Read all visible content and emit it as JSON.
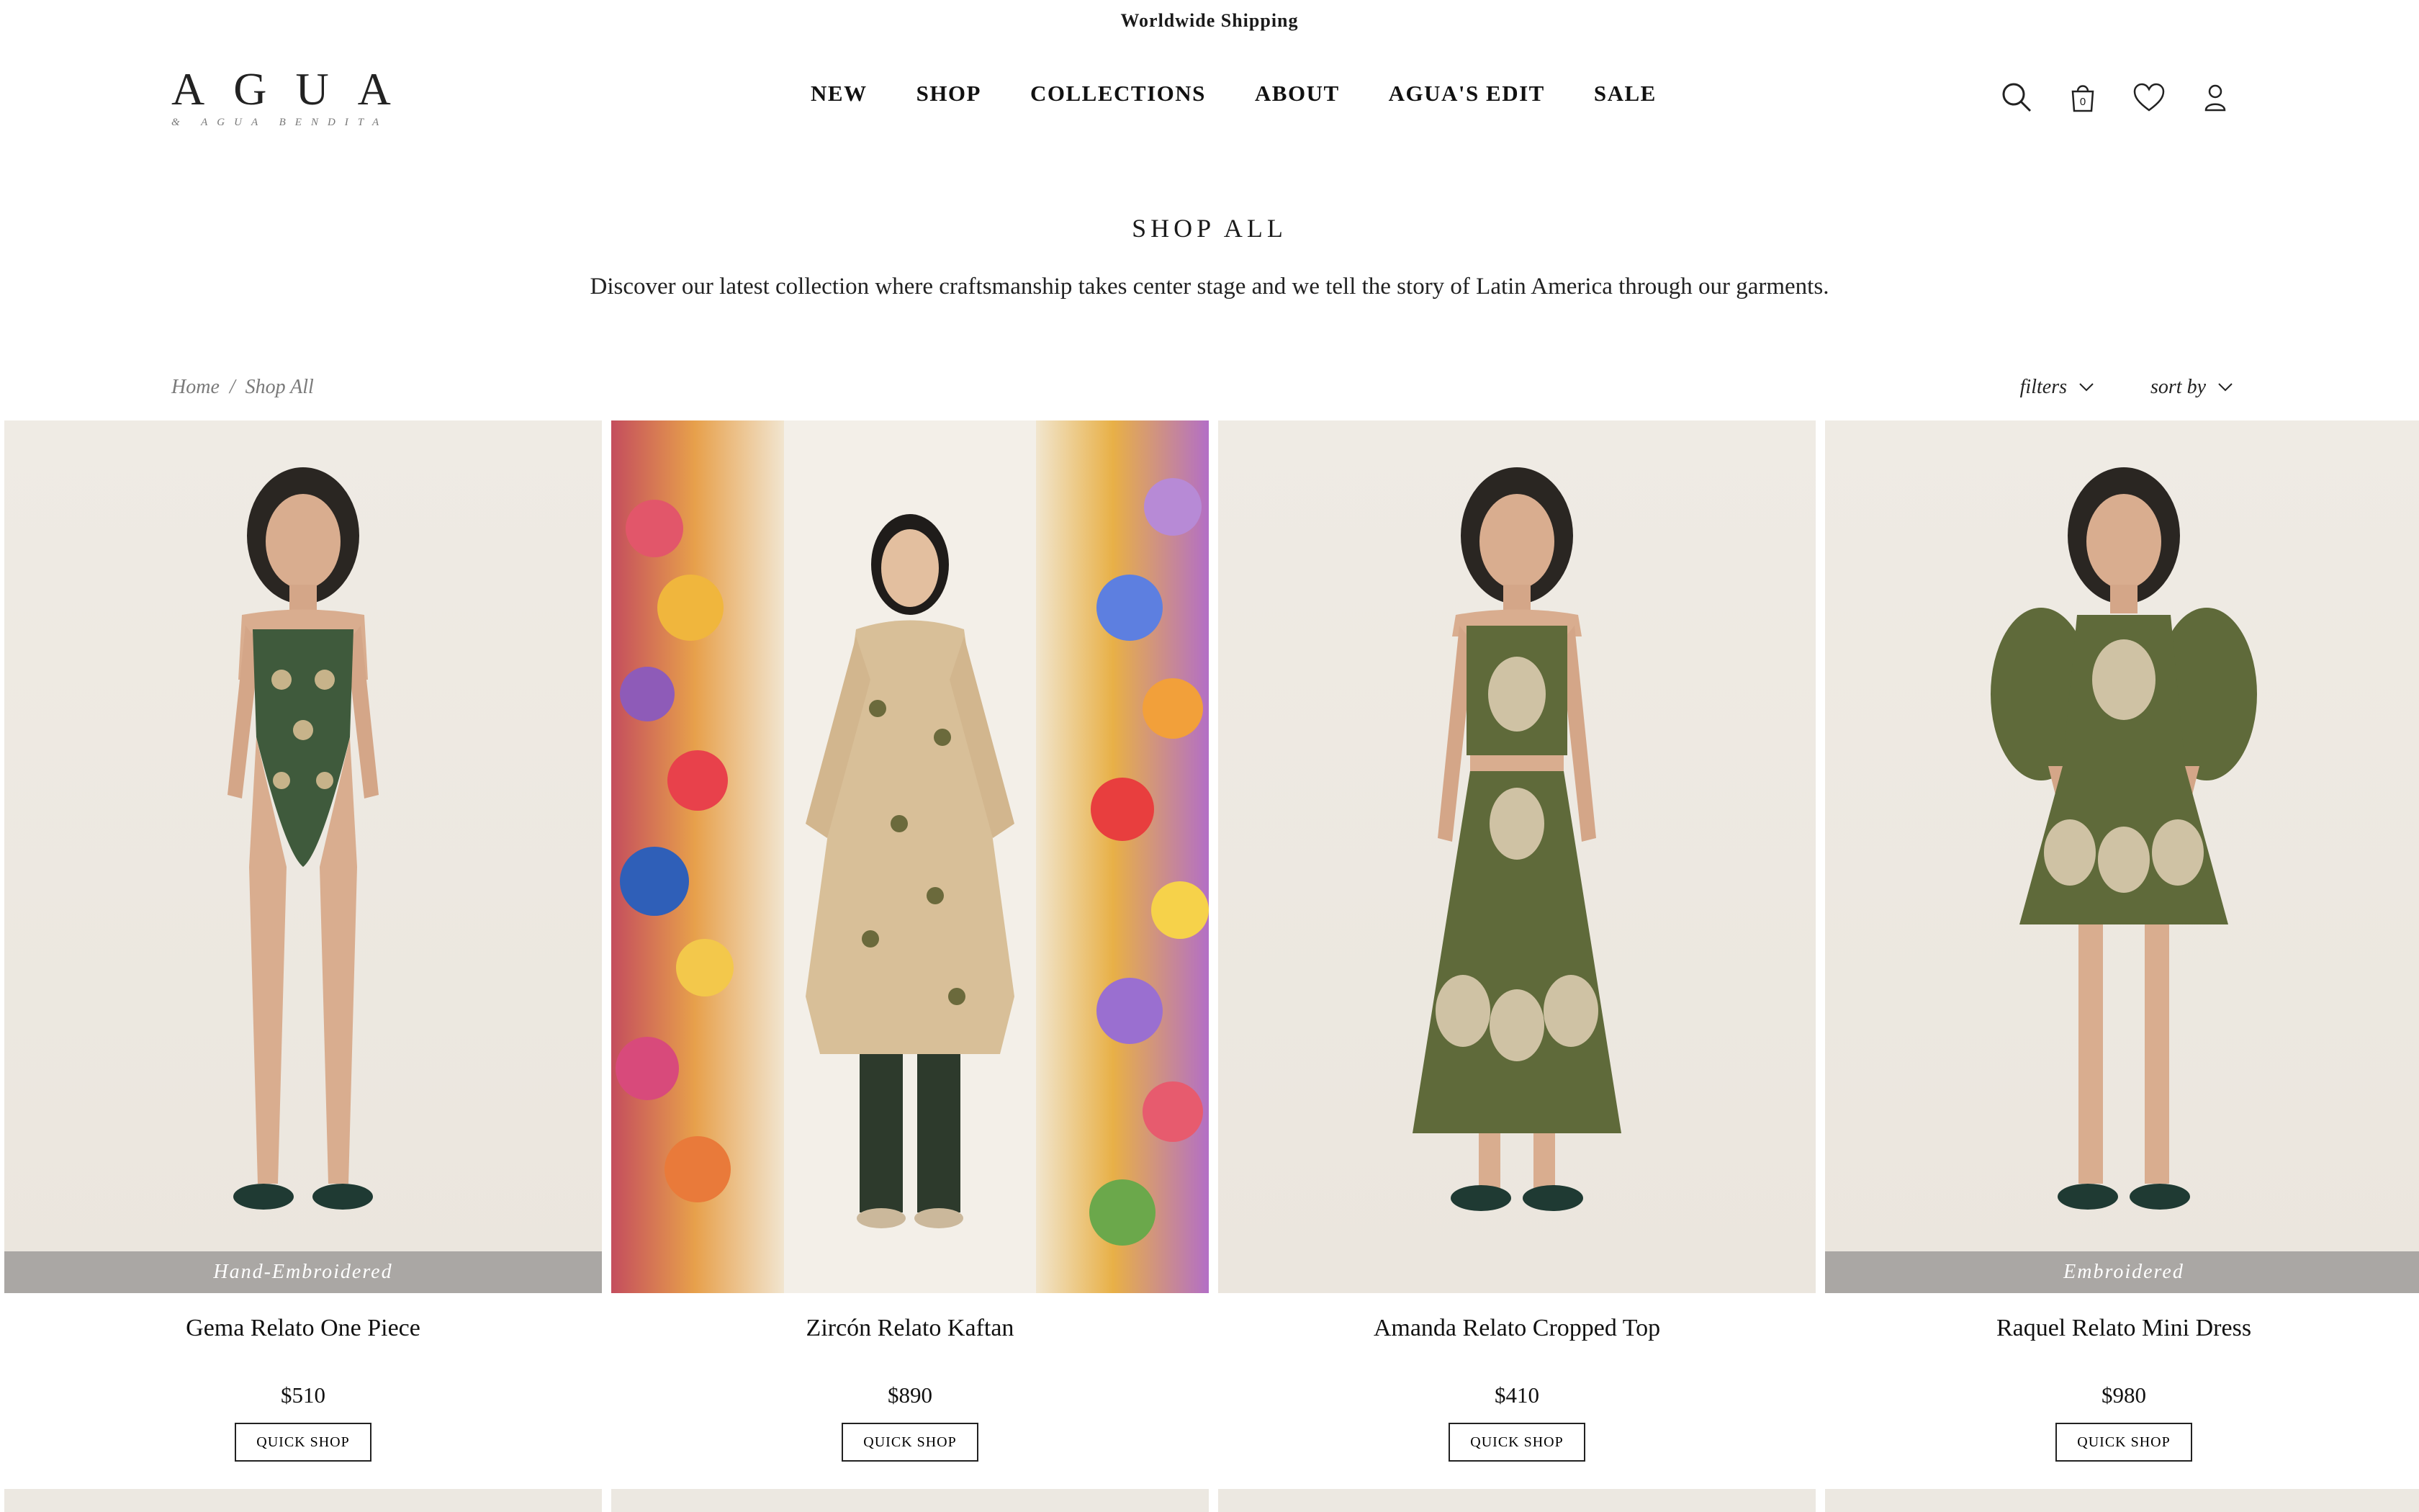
{
  "announcement": "Worldwide Shipping",
  "logo": {
    "main": "AGUA",
    "sub": "& AGUA BENDITA"
  },
  "nav": [
    "NEW",
    "SHOP",
    "COLLECTIONS",
    "ABOUT",
    "AGUA'S EDIT",
    "SALE"
  ],
  "header_icons": {
    "search": "search-icon",
    "bag": "bag-icon",
    "bag_count": "0",
    "wishlist": "heart-icon",
    "account": "user-icon"
  },
  "page": {
    "title": "SHOP ALL",
    "description": "Discover our latest collection where craftsmanship takes center stage and we tell the story of Latin America through our garments."
  },
  "breadcrumb": {
    "home": "Home",
    "sep": "/",
    "current": "Shop All"
  },
  "toolbar": {
    "filters": "filters",
    "sort": "sort by"
  },
  "products": [
    {
      "name": "Gema Relato One Piece",
      "price": "$510",
      "badge": "Hand-Embroidered",
      "quick_shop": "QUICK SHOP"
    },
    {
      "name": "Zircón Relato Kaftan",
      "price": "$890",
      "badge": "",
      "quick_shop": "QUICK SHOP"
    },
    {
      "name": "Amanda Relato Cropped Top",
      "price": "$410",
      "badge": "",
      "quick_shop": "QUICK SHOP"
    },
    {
      "name": "Raquel Relato Mini Dress",
      "price": "$980",
      "badge": "Embroidered",
      "quick_shop": "QUICK SHOP"
    }
  ],
  "colors": {
    "text": "#1a1a1a",
    "badge_bg": "#a09e9c",
    "garment_green": "#5f6a3a",
    "swimsuit_green": "#3f5a3c"
  }
}
